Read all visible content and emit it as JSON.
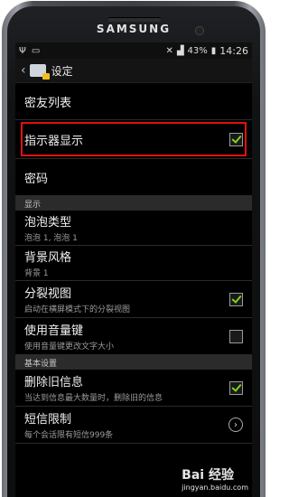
{
  "device": {
    "brand": "SAMSUNG"
  },
  "status_bar": {
    "battery": "43%",
    "time": "14:26"
  },
  "header": {
    "back_icon": "chevron-left-icon",
    "title": "设定"
  },
  "list": {
    "friend_list": {
      "title": "密友列表"
    },
    "indicator_display": {
      "title": "指示器显示",
      "checked": true
    },
    "password": {
      "title": "密码"
    }
  },
  "sections": {
    "display": "显示",
    "basic": "基本设置"
  },
  "display_items": [
    {
      "title": "泡泡类型",
      "summary": "泡泡 1, 泡泡 1"
    },
    {
      "title": "背景风格",
      "summary": "背景 1"
    },
    {
      "title": "分裂视图",
      "summary": "启动在横屏模式下的分裂视图",
      "checked": true
    },
    {
      "title": "使用音量键",
      "summary": "使用音量键更改文字大小",
      "checked": false
    }
  ],
  "basic_items": [
    {
      "title": "删除旧信息",
      "summary": "当达到信息最大数量时，删除旧的信息",
      "checked": true
    },
    {
      "title": "短信限制",
      "summary": "每个会话限有短信999条"
    }
  ],
  "watermark": {
    "text": "Bai 经验",
    "sub": "jingyan.baidu.com"
  }
}
